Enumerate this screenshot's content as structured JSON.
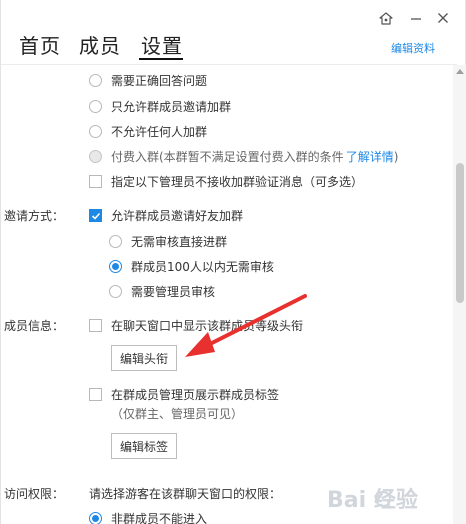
{
  "header": {
    "tabs": [
      {
        "label": "首页"
      },
      {
        "label": "成员"
      },
      {
        "label": "设置"
      }
    ],
    "edit_profile": "编辑资料",
    "icons": [
      "skin-icon",
      "minimize-icon",
      "close-icon"
    ]
  },
  "join_options": [
    {
      "label": "需要正确回答问题",
      "state": "unchecked"
    },
    {
      "label": "只允许群成员邀请加群",
      "state": "unchecked"
    },
    {
      "label": "不允许任何人加群",
      "state": "unchecked"
    },
    {
      "label": "付费入群(本群暂不满足设置付费入群的条件",
      "state": "disabled",
      "link": "了解详情",
      "suffix": ")"
    }
  ],
  "admin_verify": {
    "label": "指定以下管理员不接收加群验证消息（可多选）",
    "checked": false
  },
  "invite": {
    "section_label": "邀请方式：",
    "allow_label": "允许群成员邀请好友加群",
    "allow_checked": true,
    "options": [
      {
        "label": "无需审核直接进群",
        "checked": false
      },
      {
        "label": "群成员100人以内无需审核",
        "checked": true
      },
      {
        "label": "需要管理员审核",
        "checked": false
      }
    ]
  },
  "member_info": {
    "section_label": "成员信息：",
    "show_level_label": "在聊天窗口中显示该群成员等级头衔",
    "show_level_checked": false,
    "edit_title_button": "编辑头衔",
    "show_tags_label": "在群成员管理页展示群成员标签",
    "show_tags_checked": false,
    "show_tags_note": "（仅群主、管理员可见）",
    "edit_tags_button": "编辑标签"
  },
  "access": {
    "section_label": "访问权限：",
    "prompt": "请选择游客在该群聊天窗口的权限：",
    "option_label": "非群成员不能进入",
    "option_checked": true
  },
  "colors": {
    "accent": "#1e88e5",
    "annotation_arrow": "#e8302f"
  },
  "watermark": "Bai 经验"
}
